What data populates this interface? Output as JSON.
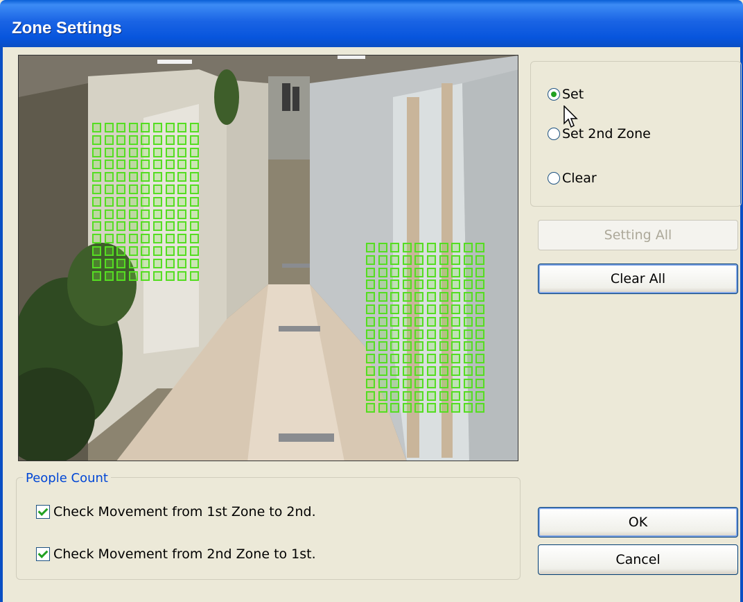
{
  "window": {
    "title": "Zone Settings"
  },
  "zone_mode": {
    "options": [
      {
        "label": "Set",
        "selected": true
      },
      {
        "label": "Set 2nd Zone",
        "selected": false
      },
      {
        "label": "Clear",
        "selected": false
      }
    ]
  },
  "actions": {
    "setting_all": "Setting All",
    "clear_all": "Clear All",
    "ok": "OK",
    "cancel": "Cancel"
  },
  "people_count": {
    "legend": "People Count",
    "options": [
      {
        "label": "Check Movement from 1st Zone to 2nd.",
        "checked": true
      },
      {
        "label": "Check Movement from 2nd Zone to 1st.",
        "checked": true
      }
    ]
  },
  "zones": [
    {
      "name": "zone-1",
      "cols": 9,
      "rows": 13
    },
    {
      "name": "zone-2",
      "cols": 10,
      "rows": 14
    }
  ],
  "colors": {
    "zone_grid": "#55dd22",
    "title_bar": "#0a5fd6",
    "dialog_bg": "#ece9d8"
  }
}
